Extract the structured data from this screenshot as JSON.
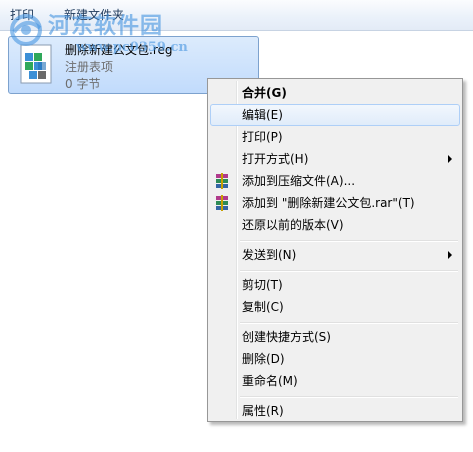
{
  "toolbar": {
    "print_label": "打印",
    "new_folder_label": "新建文件夹"
  },
  "file": {
    "name": "删除新建公文包.reg",
    "type": "注册表项",
    "size": "0 字节",
    "icon": "registry-file-icon"
  },
  "watermark": {
    "title": "河东软件园",
    "url": "www.pc0359.cn"
  },
  "menu": {
    "items": [
      {
        "label": "合并(G)",
        "bold": true
      },
      {
        "label": "编辑(E)"
      },
      {
        "label": "打印(P)"
      },
      {
        "label": "打开方式(H)",
        "submenu": true
      },
      {
        "label": "添加到压缩文件(A)...",
        "icon": "winrar-icon"
      },
      {
        "label": "添加到 \"删除新建公文包.rar\"(T)",
        "icon": "winrar-icon"
      },
      {
        "label": "还原以前的版本(V)"
      },
      {
        "label": "发送到(N)",
        "submenu": true
      },
      {
        "label": "剪切(T)"
      },
      {
        "label": "复制(C)"
      },
      {
        "label": "创建快捷方式(S)"
      },
      {
        "label": "删除(D)"
      },
      {
        "label": "重命名(M)"
      },
      {
        "label": "属性(R)"
      }
    ]
  },
  "colors": {
    "selection": "#c1dbfc",
    "menu_background": "#f0f0f0",
    "watermark": "#4896e1"
  }
}
